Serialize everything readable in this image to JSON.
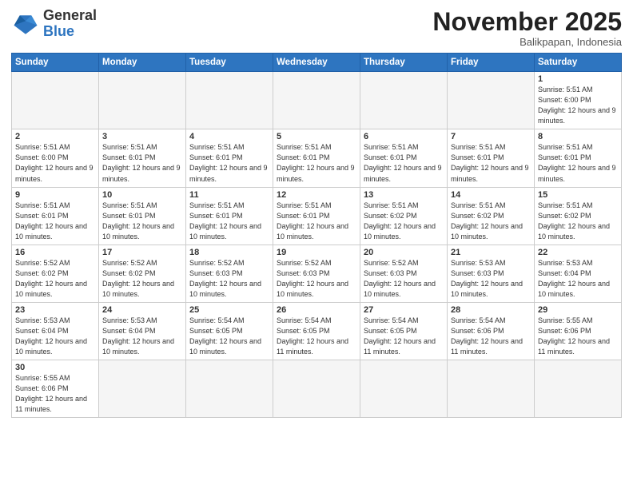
{
  "logo": {
    "general": "General",
    "blue": "Blue"
  },
  "header": {
    "month_title": "November 2025",
    "subtitle": "Balikpapan, Indonesia"
  },
  "days_of_week": [
    "Sunday",
    "Monday",
    "Tuesday",
    "Wednesday",
    "Thursday",
    "Friday",
    "Saturday"
  ],
  "weeks": [
    [
      {
        "day": "",
        "info": ""
      },
      {
        "day": "",
        "info": ""
      },
      {
        "day": "",
        "info": ""
      },
      {
        "day": "",
        "info": ""
      },
      {
        "day": "",
        "info": ""
      },
      {
        "day": "",
        "info": ""
      },
      {
        "day": "1",
        "info": "Sunrise: 5:51 AM\nSunset: 6:00 PM\nDaylight: 12 hours and 9 minutes."
      }
    ],
    [
      {
        "day": "2",
        "info": "Sunrise: 5:51 AM\nSunset: 6:00 PM\nDaylight: 12 hours and 9 minutes."
      },
      {
        "day": "3",
        "info": "Sunrise: 5:51 AM\nSunset: 6:01 PM\nDaylight: 12 hours and 9 minutes."
      },
      {
        "day": "4",
        "info": "Sunrise: 5:51 AM\nSunset: 6:01 PM\nDaylight: 12 hours and 9 minutes."
      },
      {
        "day": "5",
        "info": "Sunrise: 5:51 AM\nSunset: 6:01 PM\nDaylight: 12 hours and 9 minutes."
      },
      {
        "day": "6",
        "info": "Sunrise: 5:51 AM\nSunset: 6:01 PM\nDaylight: 12 hours and 9 minutes."
      },
      {
        "day": "7",
        "info": "Sunrise: 5:51 AM\nSunset: 6:01 PM\nDaylight: 12 hours and 9 minutes."
      },
      {
        "day": "8",
        "info": "Sunrise: 5:51 AM\nSunset: 6:01 PM\nDaylight: 12 hours and 9 minutes."
      }
    ],
    [
      {
        "day": "9",
        "info": "Sunrise: 5:51 AM\nSunset: 6:01 PM\nDaylight: 12 hours and 10 minutes."
      },
      {
        "day": "10",
        "info": "Sunrise: 5:51 AM\nSunset: 6:01 PM\nDaylight: 12 hours and 10 minutes."
      },
      {
        "day": "11",
        "info": "Sunrise: 5:51 AM\nSunset: 6:01 PM\nDaylight: 12 hours and 10 minutes."
      },
      {
        "day": "12",
        "info": "Sunrise: 5:51 AM\nSunset: 6:01 PM\nDaylight: 12 hours and 10 minutes."
      },
      {
        "day": "13",
        "info": "Sunrise: 5:51 AM\nSunset: 6:02 PM\nDaylight: 12 hours and 10 minutes."
      },
      {
        "day": "14",
        "info": "Sunrise: 5:51 AM\nSunset: 6:02 PM\nDaylight: 12 hours and 10 minutes."
      },
      {
        "day": "15",
        "info": "Sunrise: 5:51 AM\nSunset: 6:02 PM\nDaylight: 12 hours and 10 minutes."
      }
    ],
    [
      {
        "day": "16",
        "info": "Sunrise: 5:52 AM\nSunset: 6:02 PM\nDaylight: 12 hours and 10 minutes."
      },
      {
        "day": "17",
        "info": "Sunrise: 5:52 AM\nSunset: 6:02 PM\nDaylight: 12 hours and 10 minutes."
      },
      {
        "day": "18",
        "info": "Sunrise: 5:52 AM\nSunset: 6:03 PM\nDaylight: 12 hours and 10 minutes."
      },
      {
        "day": "19",
        "info": "Sunrise: 5:52 AM\nSunset: 6:03 PM\nDaylight: 12 hours and 10 minutes."
      },
      {
        "day": "20",
        "info": "Sunrise: 5:52 AM\nSunset: 6:03 PM\nDaylight: 12 hours and 10 minutes."
      },
      {
        "day": "21",
        "info": "Sunrise: 5:53 AM\nSunset: 6:03 PM\nDaylight: 12 hours and 10 minutes."
      },
      {
        "day": "22",
        "info": "Sunrise: 5:53 AM\nSunset: 6:04 PM\nDaylight: 12 hours and 10 minutes."
      }
    ],
    [
      {
        "day": "23",
        "info": "Sunrise: 5:53 AM\nSunset: 6:04 PM\nDaylight: 12 hours and 10 minutes."
      },
      {
        "day": "24",
        "info": "Sunrise: 5:53 AM\nSunset: 6:04 PM\nDaylight: 12 hours and 10 minutes."
      },
      {
        "day": "25",
        "info": "Sunrise: 5:54 AM\nSunset: 6:05 PM\nDaylight: 12 hours and 10 minutes."
      },
      {
        "day": "26",
        "info": "Sunrise: 5:54 AM\nSunset: 6:05 PM\nDaylight: 12 hours and 11 minutes."
      },
      {
        "day": "27",
        "info": "Sunrise: 5:54 AM\nSunset: 6:05 PM\nDaylight: 12 hours and 11 minutes."
      },
      {
        "day": "28",
        "info": "Sunrise: 5:54 AM\nSunset: 6:06 PM\nDaylight: 12 hours and 11 minutes."
      },
      {
        "day": "29",
        "info": "Sunrise: 5:55 AM\nSunset: 6:06 PM\nDaylight: 12 hours and 11 minutes."
      }
    ],
    [
      {
        "day": "30",
        "info": "Sunrise: 5:55 AM\nSunset: 6:06 PM\nDaylight: 12 hours and 11 minutes."
      },
      {
        "day": "",
        "info": ""
      },
      {
        "day": "",
        "info": ""
      },
      {
        "day": "",
        "info": ""
      },
      {
        "day": "",
        "info": ""
      },
      {
        "day": "",
        "info": ""
      },
      {
        "day": "",
        "info": ""
      }
    ]
  ]
}
